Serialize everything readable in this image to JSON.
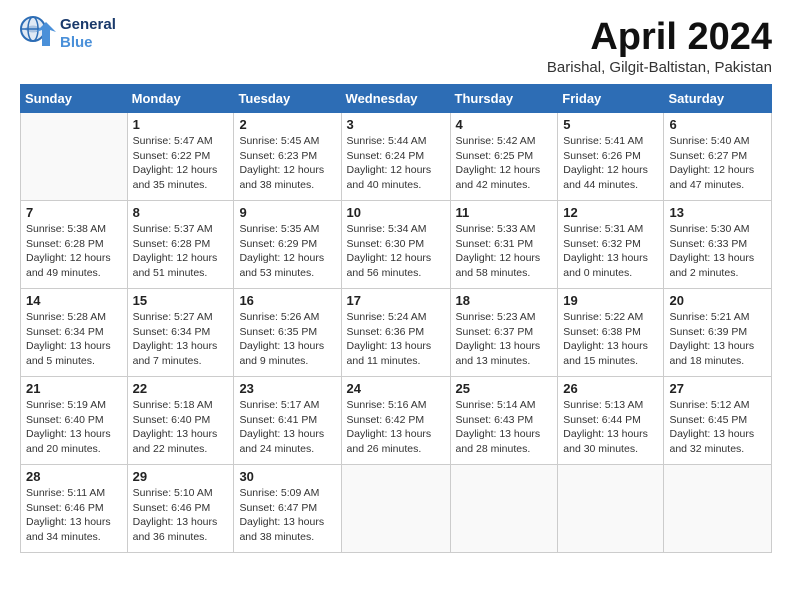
{
  "logo": {
    "line1": "General",
    "line2": "Blue"
  },
  "title": "April 2024",
  "subtitle": "Barishal, Gilgit-Baltistan, Pakistan",
  "weekdays": [
    "Sunday",
    "Monday",
    "Tuesday",
    "Wednesday",
    "Thursday",
    "Friday",
    "Saturday"
  ],
  "weeks": [
    [
      {
        "day": "",
        "info": ""
      },
      {
        "day": "1",
        "info": "Sunrise: 5:47 AM\nSunset: 6:22 PM\nDaylight: 12 hours\nand 35 minutes."
      },
      {
        "day": "2",
        "info": "Sunrise: 5:45 AM\nSunset: 6:23 PM\nDaylight: 12 hours\nand 38 minutes."
      },
      {
        "day": "3",
        "info": "Sunrise: 5:44 AM\nSunset: 6:24 PM\nDaylight: 12 hours\nand 40 minutes."
      },
      {
        "day": "4",
        "info": "Sunrise: 5:42 AM\nSunset: 6:25 PM\nDaylight: 12 hours\nand 42 minutes."
      },
      {
        "day": "5",
        "info": "Sunrise: 5:41 AM\nSunset: 6:26 PM\nDaylight: 12 hours\nand 44 minutes."
      },
      {
        "day": "6",
        "info": "Sunrise: 5:40 AM\nSunset: 6:27 PM\nDaylight: 12 hours\nand 47 minutes."
      }
    ],
    [
      {
        "day": "7",
        "info": "Sunrise: 5:38 AM\nSunset: 6:28 PM\nDaylight: 12 hours\nand 49 minutes."
      },
      {
        "day": "8",
        "info": "Sunrise: 5:37 AM\nSunset: 6:28 PM\nDaylight: 12 hours\nand 51 minutes."
      },
      {
        "day": "9",
        "info": "Sunrise: 5:35 AM\nSunset: 6:29 PM\nDaylight: 12 hours\nand 53 minutes."
      },
      {
        "day": "10",
        "info": "Sunrise: 5:34 AM\nSunset: 6:30 PM\nDaylight: 12 hours\nand 56 minutes."
      },
      {
        "day": "11",
        "info": "Sunrise: 5:33 AM\nSunset: 6:31 PM\nDaylight: 12 hours\nand 58 minutes."
      },
      {
        "day": "12",
        "info": "Sunrise: 5:31 AM\nSunset: 6:32 PM\nDaylight: 13 hours\nand 0 minutes."
      },
      {
        "day": "13",
        "info": "Sunrise: 5:30 AM\nSunset: 6:33 PM\nDaylight: 13 hours\nand 2 minutes."
      }
    ],
    [
      {
        "day": "14",
        "info": "Sunrise: 5:28 AM\nSunset: 6:34 PM\nDaylight: 13 hours\nand 5 minutes."
      },
      {
        "day": "15",
        "info": "Sunrise: 5:27 AM\nSunset: 6:34 PM\nDaylight: 13 hours\nand 7 minutes."
      },
      {
        "day": "16",
        "info": "Sunrise: 5:26 AM\nSunset: 6:35 PM\nDaylight: 13 hours\nand 9 minutes."
      },
      {
        "day": "17",
        "info": "Sunrise: 5:24 AM\nSunset: 6:36 PM\nDaylight: 13 hours\nand 11 minutes."
      },
      {
        "day": "18",
        "info": "Sunrise: 5:23 AM\nSunset: 6:37 PM\nDaylight: 13 hours\nand 13 minutes."
      },
      {
        "day": "19",
        "info": "Sunrise: 5:22 AM\nSunset: 6:38 PM\nDaylight: 13 hours\nand 15 minutes."
      },
      {
        "day": "20",
        "info": "Sunrise: 5:21 AM\nSunset: 6:39 PM\nDaylight: 13 hours\nand 18 minutes."
      }
    ],
    [
      {
        "day": "21",
        "info": "Sunrise: 5:19 AM\nSunset: 6:40 PM\nDaylight: 13 hours\nand 20 minutes."
      },
      {
        "day": "22",
        "info": "Sunrise: 5:18 AM\nSunset: 6:40 PM\nDaylight: 13 hours\nand 22 minutes."
      },
      {
        "day": "23",
        "info": "Sunrise: 5:17 AM\nSunset: 6:41 PM\nDaylight: 13 hours\nand 24 minutes."
      },
      {
        "day": "24",
        "info": "Sunrise: 5:16 AM\nSunset: 6:42 PM\nDaylight: 13 hours\nand 26 minutes."
      },
      {
        "day": "25",
        "info": "Sunrise: 5:14 AM\nSunset: 6:43 PM\nDaylight: 13 hours\nand 28 minutes."
      },
      {
        "day": "26",
        "info": "Sunrise: 5:13 AM\nSunset: 6:44 PM\nDaylight: 13 hours\nand 30 minutes."
      },
      {
        "day": "27",
        "info": "Sunrise: 5:12 AM\nSunset: 6:45 PM\nDaylight: 13 hours\nand 32 minutes."
      }
    ],
    [
      {
        "day": "28",
        "info": "Sunrise: 5:11 AM\nSunset: 6:46 PM\nDaylight: 13 hours\nand 34 minutes."
      },
      {
        "day": "29",
        "info": "Sunrise: 5:10 AM\nSunset: 6:46 PM\nDaylight: 13 hours\nand 36 minutes."
      },
      {
        "day": "30",
        "info": "Sunrise: 5:09 AM\nSunset: 6:47 PM\nDaylight: 13 hours\nand 38 minutes."
      },
      {
        "day": "",
        "info": ""
      },
      {
        "day": "",
        "info": ""
      },
      {
        "day": "",
        "info": ""
      },
      {
        "day": "",
        "info": ""
      }
    ]
  ]
}
